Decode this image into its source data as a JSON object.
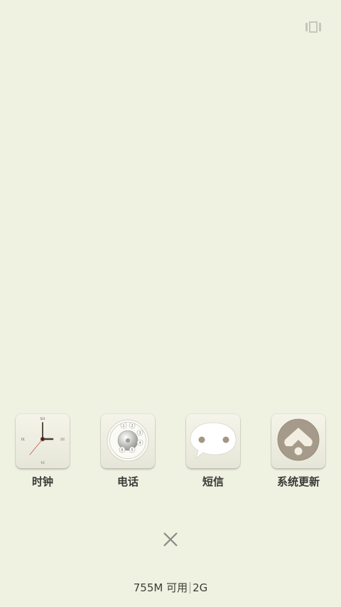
{
  "header": {
    "multiwindow_icon": "multi-window-icon"
  },
  "dock": {
    "apps": [
      {
        "label": "时钟",
        "icon": "clock-icon",
        "roman": {
          "top": "XII",
          "right": "III",
          "bottom": "VI",
          "left": "IX"
        }
      },
      {
        "label": "电话",
        "icon": "rotary-dial-icon",
        "digits": [
          "1",
          "2",
          "3",
          "4",
          "5",
          "6"
        ]
      },
      {
        "label": "短信",
        "icon": "speech-bubble-icon"
      },
      {
        "label": "系统更新",
        "icon": "system-update-icon"
      }
    ]
  },
  "footer": {
    "close_icon": "close-icon",
    "memory_text": "755M 可用",
    "memory_total": "2G"
  },
  "colors": {
    "background": "#eff1e1",
    "text": "#3a3a36"
  }
}
